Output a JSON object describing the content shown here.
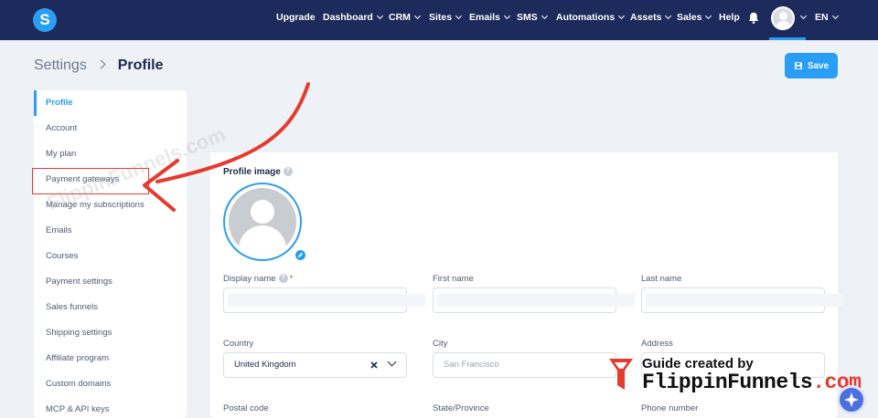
{
  "nav": {
    "logo": "S",
    "items": [
      {
        "label": "Upgrade",
        "dropdown": false
      },
      {
        "label": "Dashboard",
        "dropdown": true
      },
      {
        "label": "CRM",
        "dropdown": true
      },
      {
        "label": "Sites",
        "dropdown": true
      },
      {
        "label": "Emails",
        "dropdown": true
      },
      {
        "label": "SMS",
        "dropdown": true
      },
      {
        "label": "Automations",
        "dropdown": true
      },
      {
        "label": "Assets",
        "dropdown": true
      },
      {
        "label": "Sales",
        "dropdown": true
      },
      {
        "label": "Help",
        "dropdown": false
      }
    ],
    "language": "EN",
    "accent": "#2a9df4",
    "bar_color": "#1c2b5c"
  },
  "breadcrumb": {
    "parent": "Settings",
    "current": "Profile"
  },
  "save_label": "Save",
  "sidebar": {
    "items": [
      {
        "label": "Profile",
        "active": true
      },
      {
        "label": "Account"
      },
      {
        "label": "My plan"
      },
      {
        "label": "Payment gateways",
        "highlighted": true
      },
      {
        "label": "Manage my subscriptions"
      },
      {
        "label": "Emails"
      },
      {
        "label": "Courses"
      },
      {
        "label": "Payment settings"
      },
      {
        "label": "Sales funnels"
      },
      {
        "label": "Shipping settings"
      },
      {
        "label": "Affiliate program"
      },
      {
        "label": "Custom domains"
      },
      {
        "label": "MCP & API keys"
      }
    ]
  },
  "form": {
    "profile_image_label": "Profile image",
    "display_name_label": "Display name",
    "first_name_label": "First name",
    "last_name_label": "Last name",
    "country_label": "Country",
    "country_value": "United Kingdom",
    "city_label": "City",
    "city_placeholder": "San Francisco",
    "address_label": "Address",
    "postal_code_label": "Postal code",
    "state_label": "State/Province",
    "phone_label": "Phone number"
  },
  "overlay": {
    "watermark": "FlippinFunnels.com",
    "guide_line1": "Guide created by",
    "guide_brand": "FlippinFunnels",
    "guide_tld": ".com",
    "arrow_color": "#e53b2e"
  }
}
